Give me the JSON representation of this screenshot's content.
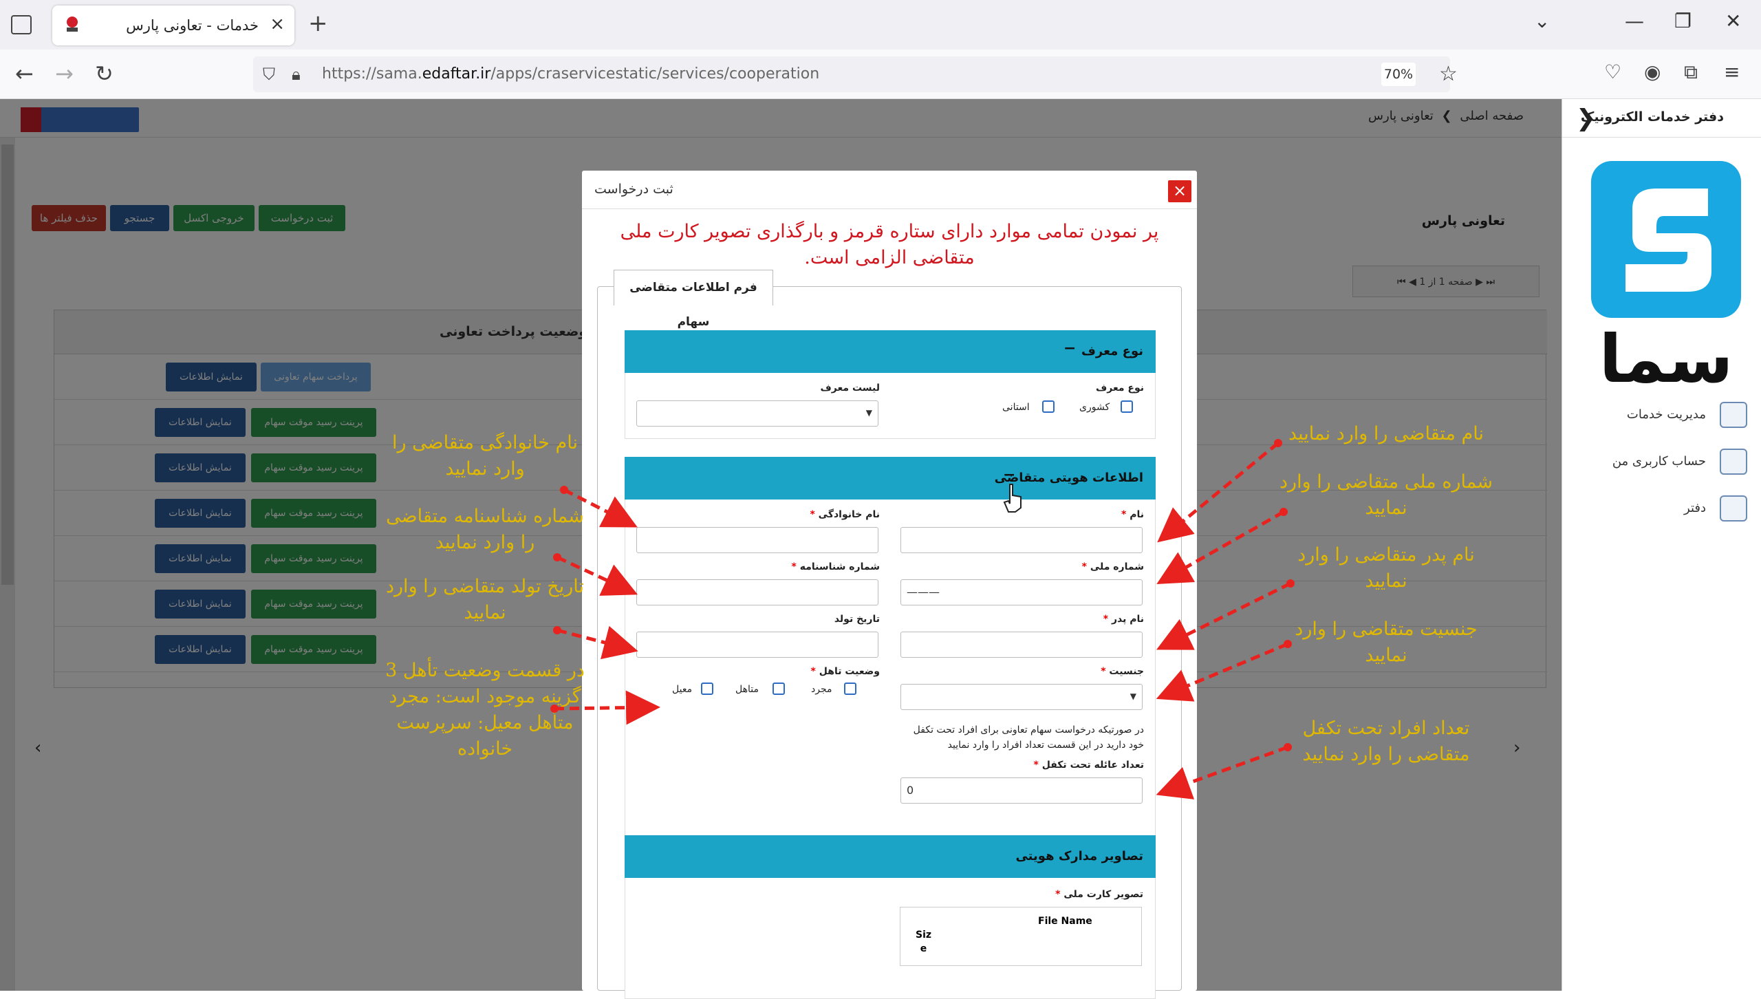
{
  "browser": {
    "tab_title": "خدمات - تعاونی پارس",
    "tab_close": "×",
    "new_tab": "+",
    "url_prefix": "https://sama.",
    "url_domain": "edaftar.ir",
    "url_path": "/apps/craservicestatic/services/cooperation",
    "zoom": "70%",
    "win_min": "—",
    "win_max": "❐",
    "win_close": "✕",
    "tabs_dropdown": "⌄"
  },
  "header": {
    "breadcrumb_home": "صفحه اصلی",
    "breadcrumb_sep": "❯",
    "breadcrumb_current": "تعاونی پارس"
  },
  "sidebar": {
    "title": "دفتر خدمات الکترونیک",
    "chevron": "❯",
    "logo_text": "سما",
    "items": [
      {
        "label": "مدیریت خدمات",
        "icon": "services-grid-icon"
      },
      {
        "label": "حساب کاربری من",
        "icon": "gear-icon"
      },
      {
        "label": "دفتر",
        "icon": "office-grid-icon"
      }
    ]
  },
  "content": {
    "title": "تعاونی پارس",
    "actions": {
      "clear_filters": "حذف فیلتر ها",
      "search": "جستجو",
      "excel": "خروجی اکسل",
      "new_request": "ثبت درخواست"
    },
    "pager": "صفحه 1 از 1",
    "grid_header": "وضعیت پرداخت تعاونی",
    "rows": [
      {
        "primary": "پرداخت سهام تعاونی",
        "secondary": "نمایش اطلاعات"
      },
      {
        "primary": "پرینت رسید موقت سهام",
        "secondary": "نمایش اطلاعات"
      },
      {
        "primary": "پرینت رسید موقت سهام",
        "secondary": "نمایش اطلاعات"
      },
      {
        "primary": "پرینت رسید موقت سهام",
        "secondary": "نمایش اطلاعات"
      },
      {
        "primary": "پرینت رسید موقت سهام",
        "secondary": "نمایش اطلاعات"
      },
      {
        "primary": "پرینت رسید موقت سهام",
        "secondary": "نمایش اطلاعات"
      },
      {
        "primary": "پرینت رسید موقت سهام",
        "secondary": "نمایش اطلاعات"
      }
    ]
  },
  "modal": {
    "title": "ثبت درخواست",
    "close": "×",
    "warning": "پر نمودن تمامی موارد دارای ستاره قرمز و بارگذاری تصویر کارت ملی متقاضی الزامی است.",
    "form_tab": "فرم اطلاعات متقاضی سهام",
    "section_referrer": {
      "title": "نوع معرف",
      "type_label": "نوع معرف",
      "opt_national": "کشوری",
      "opt_provincial": "استانی",
      "list_label": "لیست معرف"
    },
    "section_identity": {
      "title": "اطلاعات هویتی متقاضی",
      "first_name": "نام",
      "last_name": "نام خانوادگی",
      "national_code": "شماره ملی",
      "national_code_value": "———",
      "birth_cert": "شماره شناسنامه",
      "father_name": "نام پدر",
      "birth_date": "تاریخ تولد",
      "gender": "جنسیت",
      "marital": "وضعیت تاهل",
      "opt_single": "مجرد",
      "opt_married": "متاهل",
      "opt_head": "معیل",
      "dependents_note": "در صورتیکه درخواست سهام تعاونی برای افراد تحت تکفل خود دارید در این قسمت تعداد افراد را وارد نمایید",
      "dependents_label": "تعداد عائله تحت تکفل",
      "dependents_value": "0"
    },
    "section_docs": {
      "title": "تصاویر مدارک هویتی",
      "id_card": "تصویر کارت ملی",
      "file_name": "File Name",
      "size": "Siz\ne"
    }
  },
  "annotations": {
    "last_name": "نام خانوادگی متقاضی را وارد نمایید",
    "birth_cert": "شماره شناسنامه متقاضی را وارد نمایید",
    "birth_date": "تاریخ تولد متقاضی را وارد نمایید",
    "marital": "در قسمت وضعیت تأهل 3 گزینه موجود است: مجرد متأهل معیل: سرپرست خانواده",
    "first_name": "نام متقاضی را وارد نمایید",
    "national_code": "شماره ملی متقاضی را وارد نمایید",
    "father_name": "نام پدر متقاضی را وارد نمایید",
    "gender": "جنسیت متقاضی را وارد نمایید",
    "dependents": "تعداد افراد تحت تکفل متقاضی را وارد نمایید"
  },
  "colors": {
    "section_header": "#1ca4c6",
    "warning_red": "#d0171f",
    "annotation_yellow": "#e0b800",
    "arrow_red": "#e8231f",
    "close_red": "#d9221c",
    "btn_green": "#2e9a4f",
    "btn_blue": "#2c5f9e",
    "btn_red": "#c0392b"
  }
}
